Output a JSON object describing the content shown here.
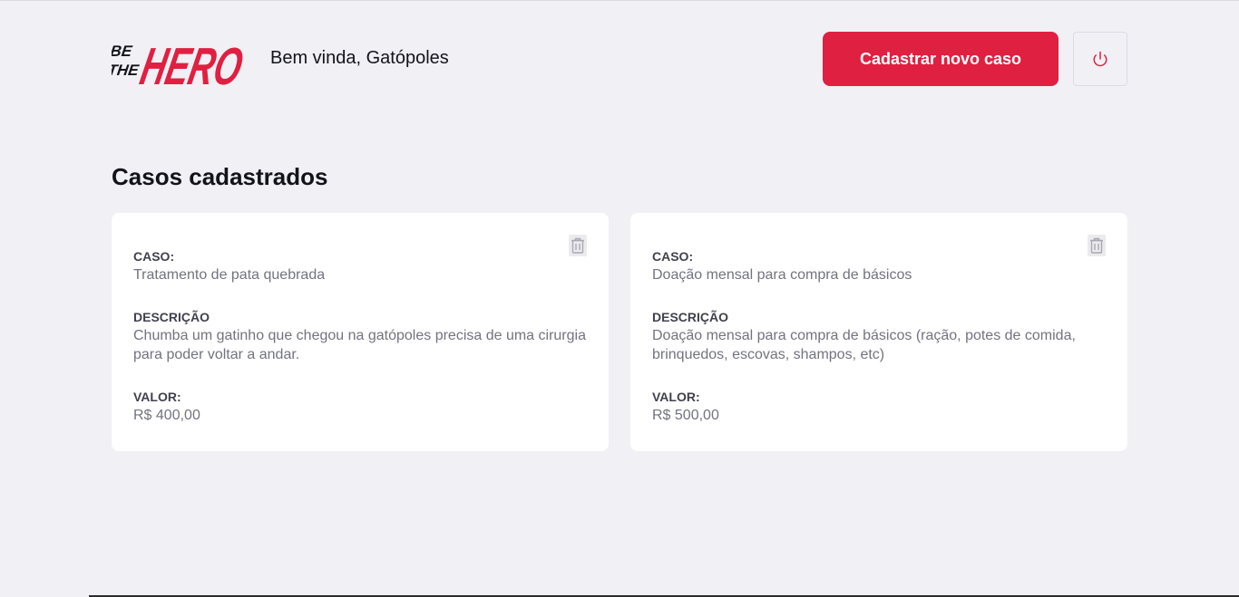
{
  "header": {
    "logo_text": [
      "BE",
      "THE",
      "HERO"
    ],
    "welcome": "Bem vinda, Gatópoles",
    "new_case_button": "Cadastrar novo caso",
    "logout_icon": "power-icon"
  },
  "main": {
    "title": "Casos cadastrados",
    "cases": [
      {
        "case_label": "CASO:",
        "case_value": "Tratamento de pata quebrada",
        "desc_label": "DESCRIÇÃO",
        "desc_value": "Chumba um gatinho que chegou na gatópoles precisa de uma cirurgia para poder voltar a andar.",
        "value_label": "VALOR:",
        "value_value": "R$ 400,00"
      },
      {
        "case_label": "CASO:",
        "case_value": "Doação mensal para compra de básicos",
        "desc_label": "DESCRIÇÃO",
        "desc_value": "Doação mensal para compra de básicos (ração, potes de comida, brinquedos, escovas, shampos, etc)",
        "value_label": "VALOR:",
        "value_value": "R$ 500,00"
      }
    ]
  },
  "colors": {
    "brand": "#e02041",
    "background": "#f0f0f5",
    "card": "#ffffff",
    "label": "#41414d",
    "muted": "#737380"
  }
}
